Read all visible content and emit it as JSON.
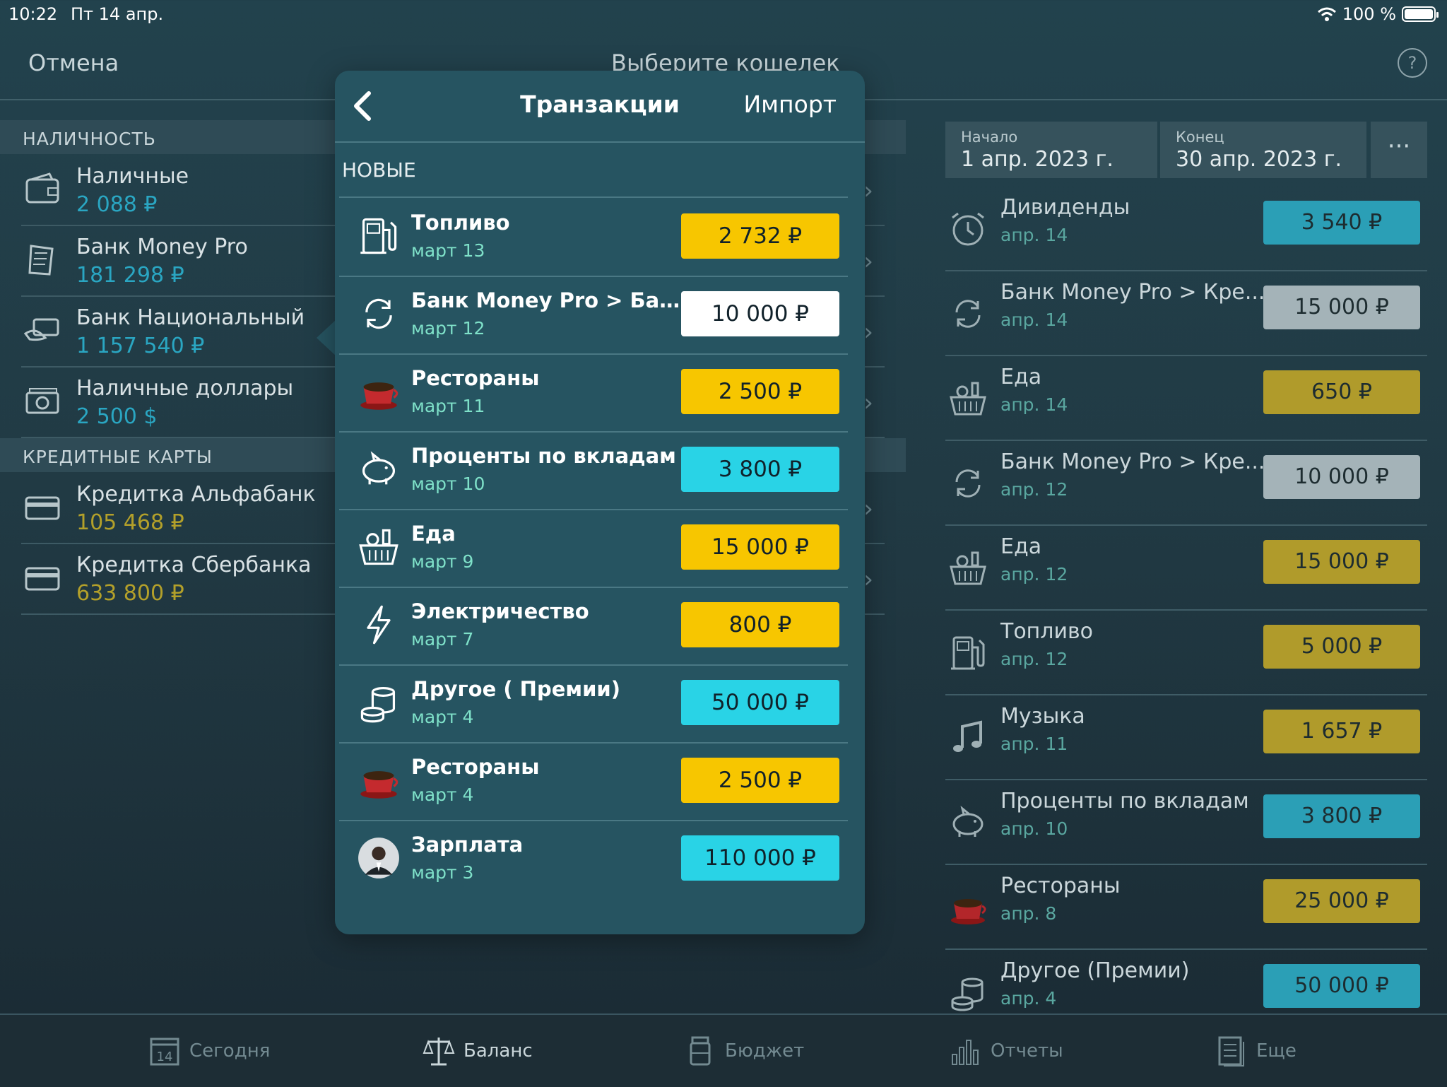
{
  "status": {
    "time": "10:22",
    "date": "Пт 14 апр.",
    "battery": "100 %"
  },
  "nav": {
    "cancel": "Отмена",
    "title": "Выберите кошелек",
    "help": "?"
  },
  "wallets": {
    "sections": [
      {
        "title": "НАЛИЧНОСТЬ",
        "items": [
          {
            "name": "Наличные",
            "amount": "2 088 ₽",
            "icon": "wallet-icon",
            "tone": "teal"
          },
          {
            "name": "Банк Money Pro",
            "amount": "181 298 ₽",
            "icon": "receipt-icon",
            "tone": "teal"
          },
          {
            "name": "Банк Национальный",
            "amount": "1 157 540 ₽",
            "icon": "card-hand-icon",
            "tone": "teal"
          },
          {
            "name": "Наличные доллары",
            "amount": "2 500 $",
            "icon": "banknotes-icon",
            "tone": "teal"
          }
        ]
      },
      {
        "title": "КРЕДИТНЫЕ КАРТЫ",
        "items": [
          {
            "name": "Кредитка Альфабанк",
            "amount": "105 468 ₽",
            "icon": "credit-card-icon",
            "tone": "gold"
          },
          {
            "name": "Кредитка Сбербанка",
            "amount": "633 800 ₽",
            "icon": "credit-card-icon",
            "tone": "gold"
          }
        ]
      }
    ]
  },
  "range": {
    "start_label": "Начало",
    "start": "1 апр. 2023 г.",
    "end_label": "Конец",
    "end": "30 апр. 2023 г.",
    "more": "···"
  },
  "recent": [
    {
      "name": "Дивиденды",
      "date": "апр. 14",
      "amount": "3 540 ₽",
      "color": "#2b9fb6",
      "icon": "alarm-clock-icon"
    },
    {
      "name": "Банк Money Pro > Кре...",
      "date": "апр. 14",
      "amount": "15 000 ₽",
      "color": "#a4b3b8",
      "icon": "transfer-icon"
    },
    {
      "name": "Еда",
      "date": "апр. 14",
      "amount": "650 ₽",
      "color": "#b09b2b",
      "icon": "basket-icon"
    },
    {
      "name": "Банк Money Pro > Кре...",
      "date": "апр. 12",
      "amount": "10 000 ₽",
      "color": "#a4b3b8",
      "icon": "transfer-icon"
    },
    {
      "name": "Еда",
      "date": "апр. 12",
      "amount": "15 000 ₽",
      "color": "#b09b2b",
      "icon": "basket-icon"
    },
    {
      "name": "Топливо",
      "date": "апр. 12",
      "amount": "5 000 ₽",
      "color": "#b09b2b",
      "icon": "fuel-icon"
    },
    {
      "name": "Музыка",
      "date": "апр. 11",
      "amount": "1 657 ₽",
      "color": "#b09b2b",
      "icon": "music-note-icon"
    },
    {
      "name": "Проценты по вкладам",
      "date": "апр. 10",
      "amount": "3 800 ₽",
      "color": "#2b9fb6",
      "icon": "piggy-bank-icon"
    },
    {
      "name": "Рестораны",
      "date": "апр. 8",
      "amount": "25 000 ₽",
      "color": "#b09b2b",
      "icon": "coffee-cup-icon"
    },
    {
      "name": "Другое (Премии)",
      "date": "апр. 4",
      "amount": "50 000 ₽",
      "color": "#2b9fb6",
      "icon": "coins-icon"
    }
  ],
  "popover": {
    "title": "Транзакции",
    "import": "Импорт",
    "section": "НОВЫЕ",
    "items": [
      {
        "name": "Топливо",
        "date": "март 13",
        "amount": "2 732 ₽",
        "color": "#f7c600",
        "icon": "fuel-icon"
      },
      {
        "name": "Банк Money Pro > Банк...",
        "date": "март 12",
        "amount": "10 000 ₽",
        "color": "#ffffff",
        "icon": "transfer-icon"
      },
      {
        "name": "Рестораны",
        "date": "март 11",
        "amount": "2 500 ₽",
        "color": "#f7c600",
        "icon": "coffee-cup-icon"
      },
      {
        "name": "Проценты по вкладам",
        "date": "март 10",
        "amount": "3 800 ₽",
        "color": "#29d3e6",
        "icon": "piggy-bank-icon"
      },
      {
        "name": "Еда",
        "date": "март 9",
        "amount": "15 000 ₽",
        "color": "#f7c600",
        "icon": "basket-icon"
      },
      {
        "name": "Электричество",
        "date": "март 7",
        "amount": "800 ₽",
        "color": "#f7c600",
        "icon": "lightning-icon"
      },
      {
        "name": "Другое ( Премии)",
        "date": "март 4",
        "amount": "50 000 ₽",
        "color": "#29d3e6",
        "icon": "coins-icon"
      },
      {
        "name": "Рестораны",
        "date": "март 4",
        "amount": "2 500 ₽",
        "color": "#f7c600",
        "icon": "coffee-cup-icon"
      },
      {
        "name": "Зарплата",
        "date": "март 3",
        "amount": "110 000 ₽",
        "color": "#29d3e6",
        "icon": "person-avatar-icon"
      }
    ]
  },
  "tabs": [
    {
      "label": "Сегодня",
      "icon": "calendar-icon",
      "day": "14",
      "active": false
    },
    {
      "label": "Баланс",
      "icon": "scales-icon",
      "active": true
    },
    {
      "label": "Бюджет",
      "icon": "jar-icon",
      "active": false
    },
    {
      "label": "Отчеты",
      "icon": "bar-chart-icon",
      "active": false
    },
    {
      "label": "Еще",
      "icon": "document-icon",
      "active": false
    }
  ]
}
